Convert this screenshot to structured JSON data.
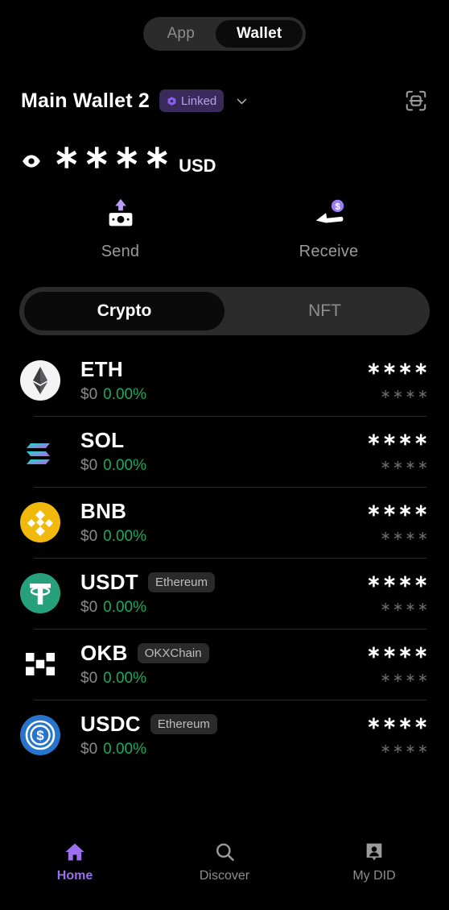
{
  "top_toggle": {
    "options": [
      {
        "label": "App",
        "active": false
      },
      {
        "label": "Wallet",
        "active": true
      }
    ],
    "app_label": "App",
    "wallet_label": "Wallet"
  },
  "wallet_header": {
    "name": "Main Wallet 2",
    "badge_label": "Linked",
    "badge_bg": "#3a2a5c",
    "badge_text_color": "#b9a0e8",
    "chevron_icon": "chevron-down-icon",
    "scan_icon": "scan-qr-icon"
  },
  "balance": {
    "eye_icon": "eye-icon",
    "hidden_value": "∗∗∗∗",
    "currency": "USD"
  },
  "actions": [
    {
      "label": "Send",
      "icon": "send-banknote-up-icon"
    },
    {
      "label": "Receive",
      "icon": "receive-hand-coin-icon"
    }
  ],
  "asset_tabs": [
    {
      "label": "Crypto",
      "active": true
    },
    {
      "label": "NFT",
      "active": false
    }
  ],
  "tokens": [
    {
      "symbol": "ETH",
      "chain": "",
      "price": "$0",
      "change": "0.00%",
      "amount": "∗∗∗∗",
      "value": "∗∗∗∗",
      "icon": "eth-icon",
      "color": "#ffffff"
    },
    {
      "symbol": "SOL",
      "chain": "",
      "price": "$0",
      "change": "0.00%",
      "amount": "∗∗∗∗",
      "value": "∗∗∗∗",
      "icon": "sol-icon",
      "color": "#14e3c1"
    },
    {
      "symbol": "BNB",
      "chain": "",
      "price": "$0",
      "change": "0.00%",
      "amount": "∗∗∗∗",
      "value": "∗∗∗∗",
      "icon": "bnb-icon",
      "color": "#f0b90b"
    },
    {
      "symbol": "USDT",
      "chain": "Ethereum",
      "price": "$0",
      "change": "0.00%",
      "amount": "∗∗∗∗",
      "value": "∗∗∗∗",
      "icon": "usdt-icon",
      "color": "#26a17b"
    },
    {
      "symbol": "OKB",
      "chain": "OKXChain",
      "price": "$0",
      "change": "0.00%",
      "amount": "∗∗∗∗",
      "value": "∗∗∗∗",
      "icon": "okb-icon",
      "color": "#ffffff"
    },
    {
      "symbol": "USDC",
      "chain": "Ethereum",
      "price": "$0",
      "change": "0.00%",
      "amount": "∗∗∗∗",
      "value": "∗∗∗∗",
      "icon": "usdc-icon",
      "color": "#2775ca"
    }
  ],
  "bottom_nav": [
    {
      "label": "Home",
      "icon": "home-icon",
      "active": true
    },
    {
      "label": "Discover",
      "icon": "search-icon",
      "active": false
    },
    {
      "label": "My DID",
      "icon": "person-badge-icon",
      "active": false
    }
  ],
  "theme": {
    "background": "#000000",
    "accent_purple": "#9b6ff0",
    "positive_green": "#1fa95f",
    "muted_text": "#8a8a8a"
  }
}
